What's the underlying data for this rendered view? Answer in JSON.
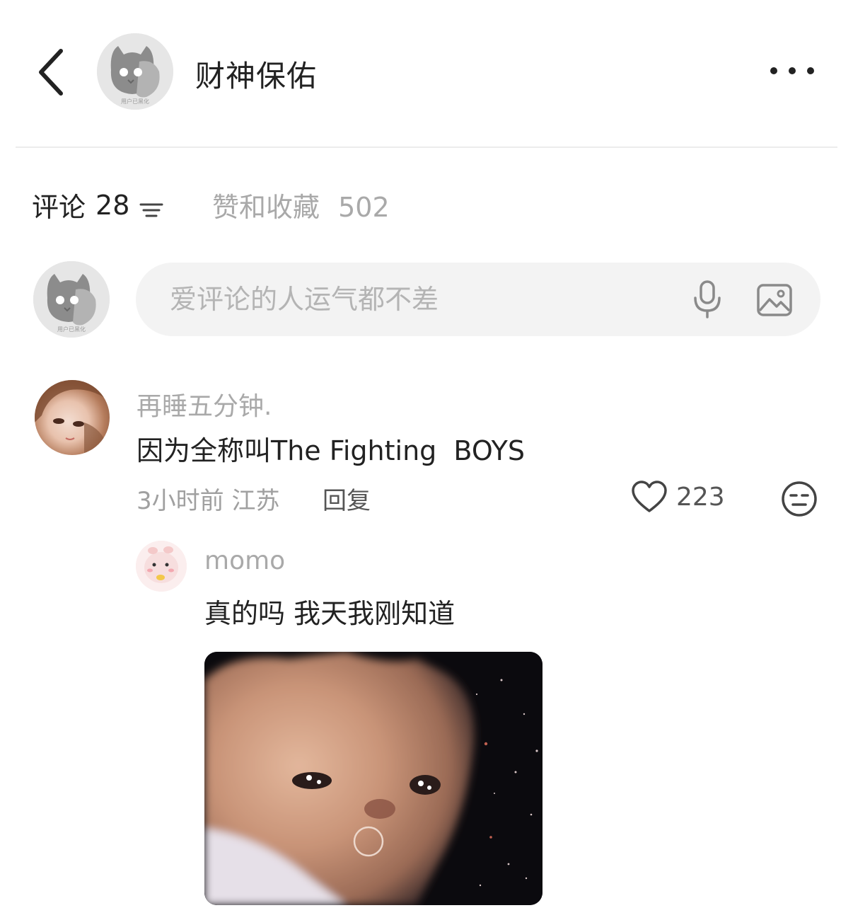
{
  "header": {
    "author_name": "财神保佑",
    "avatar_caption": "用户已黑化"
  },
  "tabs": {
    "comments_label": "评论",
    "comments_count": "28",
    "likes_label": "赞和收藏",
    "likes_count": "502"
  },
  "composer": {
    "avatar_caption": "用户已黑化",
    "placeholder": "爱评论的人运气都不差"
  },
  "comment": {
    "username": "再睡五分钟.",
    "text": "因为全称叫The Fighting  BOYS",
    "meta": "3小时前 江苏",
    "reply_label": "回复",
    "like_count": "223"
  },
  "reply": {
    "username": "momo",
    "text": "真的吗 我天我刚知道"
  },
  "colors": {
    "primary_text": "#222222",
    "secondary_text": "#a9a9a9",
    "input_bg": "#f3f3f3",
    "divider": "#ececec"
  }
}
